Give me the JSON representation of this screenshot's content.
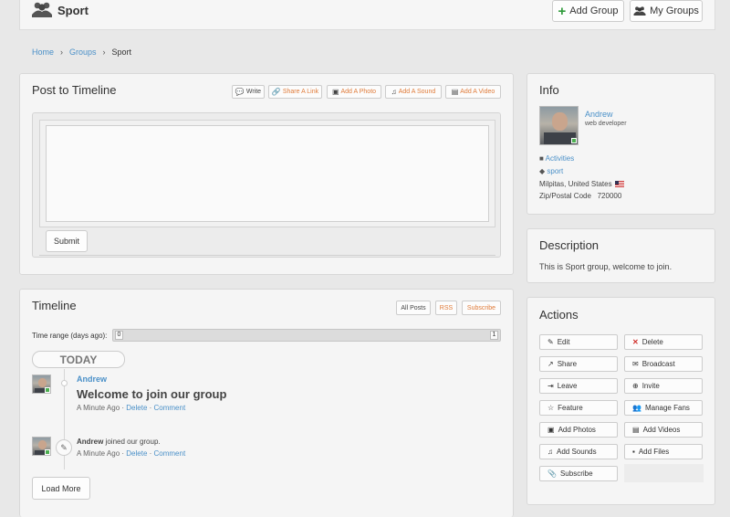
{
  "header": {
    "title": "Sport",
    "add_group": "Add Group",
    "my_groups": "My Groups"
  },
  "breadcrumb": {
    "home": "Home",
    "groups": "Groups",
    "current": "Sport",
    "sep": "›"
  },
  "post": {
    "title": "Post to Timeline",
    "tabs": [
      "Write",
      "Share A Link",
      "Add A Photo",
      "Add A Sound",
      "Add A Video"
    ],
    "submit": "Submit"
  },
  "timeline": {
    "title": "Timeline",
    "all_posts": "All Posts",
    "rss": "RSS",
    "subscribe": "Subscribe",
    "range_label": "Time range (days ago):",
    "range_min": "0",
    "range_max": "1",
    "today": "TODAY",
    "entries": [
      {
        "author": "Andrew",
        "headline": "Welcome to join our group",
        "time": "A Minute Ago",
        "delete": "Delete",
        "comment": "Comment"
      },
      {
        "author": "Andrew",
        "text": "joined our group.",
        "time": "A Minute Ago",
        "delete": "Delete",
        "comment": "Comment"
      }
    ],
    "load_more": "Load More"
  },
  "info": {
    "title": "Info",
    "name": "Andrew",
    "role": "web developer",
    "category": "Activities",
    "tag": "sport",
    "location": "Milpitas, United States",
    "zip_label": "Zip/Postal Code",
    "zip": "720000"
  },
  "description": {
    "title": "Description",
    "text": "This is Sport group, welcome to join."
  },
  "actions": {
    "title": "Actions",
    "items": [
      "Edit",
      "Delete",
      "Share",
      "Broadcast",
      "Leave",
      "Invite",
      "Feature",
      "Manage Fans",
      "Add Photos",
      "Add Videos",
      "Add Sounds",
      "Add Files",
      "Subscribe"
    ]
  },
  "colors": {
    "link": "#4a90c8",
    "accent_orange": "#e07b39",
    "online": "#4caf50",
    "delete_red": "#d0312d",
    "add_green": "#2e9a3a"
  }
}
